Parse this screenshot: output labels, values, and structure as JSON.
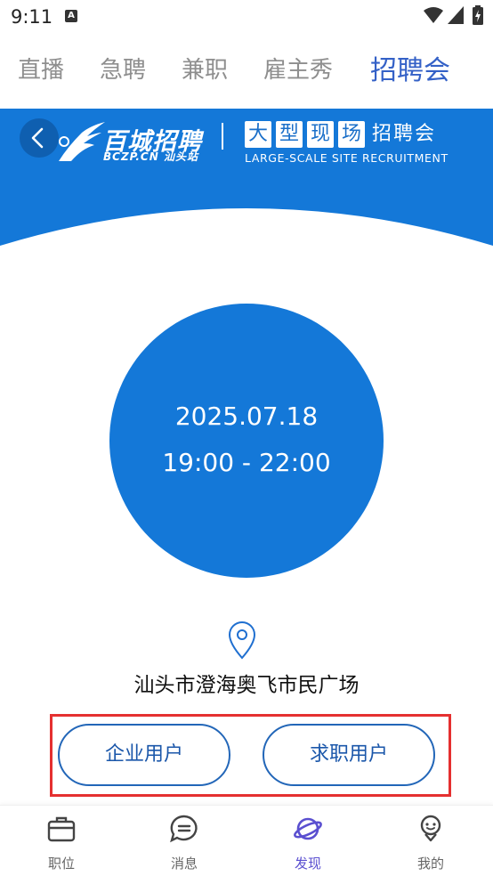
{
  "status_bar": {
    "time": "9:11",
    "notification_icon_letter": "A",
    "icons": [
      "wifi-icon",
      "cellular-icon",
      "battery-charging-icon"
    ]
  },
  "top_tabs": [
    {
      "label": "直播",
      "active": false
    },
    {
      "label": "急聘",
      "active": false
    },
    {
      "label": "兼职",
      "active": false
    },
    {
      "label": "雇主秀",
      "active": false
    },
    {
      "label": "招聘会",
      "active": true
    }
  ],
  "header": {
    "back_icon": "chevron-left-icon",
    "brand_name": "百城招聘",
    "brand_url": "BCZP.CN 汕头站",
    "fair_boxed_chars": [
      "大",
      "型",
      "现",
      "场"
    ],
    "fair_plain": "招聘会",
    "fair_subtitle": "LARGE-SCALE SITE RECRUITMENT"
  },
  "event": {
    "date": "2025.07.18",
    "time": "19:00 - 22:00",
    "location_icon": "map-pin-icon",
    "address": "汕头市澄海奥飞市民广场"
  },
  "actions": {
    "enterprise_label": "企业用户",
    "jobseeker_label": "求职用户"
  },
  "bottom_nav": [
    {
      "label": "职位",
      "icon": "briefcase-icon",
      "active": false
    },
    {
      "label": "消息",
      "icon": "chat-bubble-icon",
      "active": false
    },
    {
      "label": "发现",
      "icon": "planet-icon",
      "active": true
    },
    {
      "label": "我的",
      "icon": "person-face-icon",
      "active": false
    }
  ],
  "colors": {
    "brand_blue": "#1478d8",
    "active_tab": "#3461c7",
    "active_nav": "#5a4fd0",
    "button_border": "#2266b8",
    "highlight": "#e53030"
  }
}
